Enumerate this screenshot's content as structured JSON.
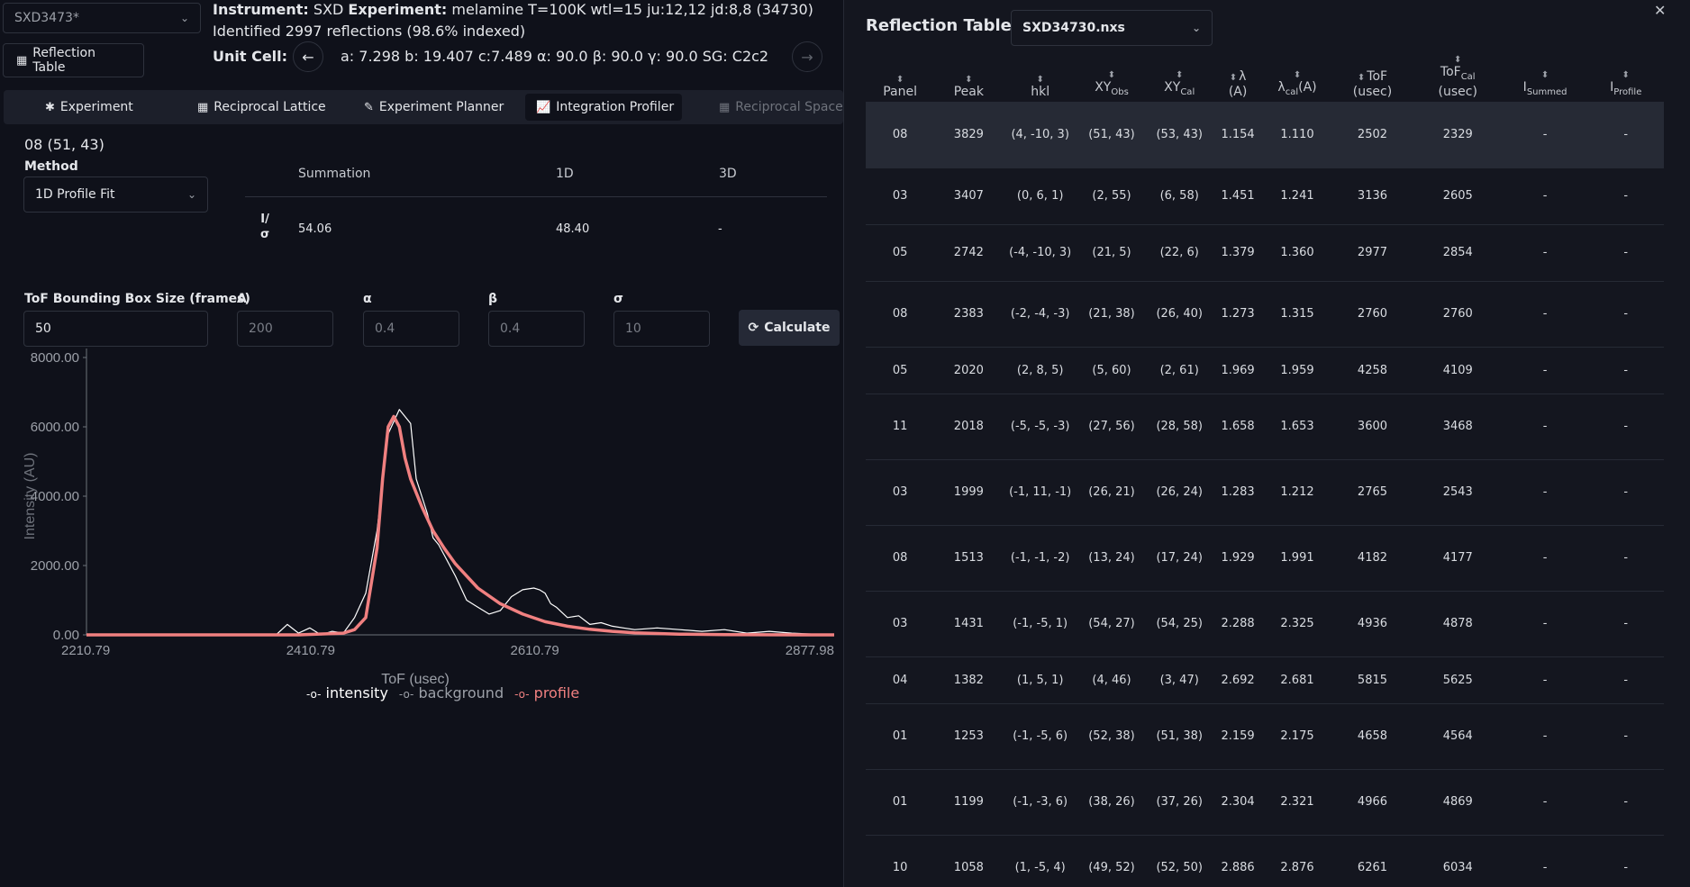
{
  "dataset_select": {
    "value": "SXD3473*"
  },
  "reflection_table_button": "Reflection Table",
  "info": {
    "instrument_label": "Instrument:",
    "instrument_value": "SXD",
    "experiment_label": "Experiment:",
    "experiment_value": "melamine T=100K wtl=15 ju:12,12 jd:8,8 (34730)",
    "identified": "Identified 2997 reflections (98.6% indexed)",
    "unit_cell_label": "Unit Cell:",
    "unit_cell_value": "a: 7.298 b: 19.407 c:7.489 α: 90.0 β: 90.0 γ: 90.0 SG: C2c2"
  },
  "tabs": [
    {
      "label": "Experiment",
      "icon": "asterisk-icon"
    },
    {
      "label": "Reciprocal Lattice",
      "icon": "grid-icon"
    },
    {
      "label": "Experiment Planner",
      "icon": "pencil-icon"
    },
    {
      "label": "Integration Profiler",
      "icon": "chart-icon",
      "active": true
    },
    {
      "label": "Reciprocal Space",
      "icon": "grid-icon",
      "disabled": true
    }
  ],
  "profiler": {
    "peak_title": "08 (51, 43)",
    "method_label": "Method",
    "method_value": "1D Profile Fit",
    "result_headers": [
      "Summation",
      "1D",
      "3D"
    ],
    "result_row_label_top": "I/",
    "result_row_label_bottom": "σ",
    "result_values": [
      "54.06",
      "48.40",
      "-"
    ],
    "tof_box_label": "ToF Bounding Box Size (frames)",
    "tof_box_value": "50",
    "param_labels": [
      "A",
      "α",
      "β",
      "σ"
    ],
    "param_placeholders": [
      "200",
      "0.4",
      "0.4",
      "10"
    ],
    "calculate_label": "Calculate"
  },
  "chart_data": {
    "type": "line",
    "xlabel": "ToF (usec)",
    "ylabel": "Intensity (AU)",
    "xlim": [
      2210.79,
      2877.98
    ],
    "ylim": [
      0,
      8000
    ],
    "x_ticks": [
      "2210.79",
      "2410.79",
      "2610.79",
      "2877.98"
    ],
    "y_ticks": [
      "0.00",
      "2000.00",
      "4000.00",
      "6000.00",
      "8000.00"
    ],
    "legend": [
      "intensity",
      "background",
      "profile"
    ],
    "legend_colors": {
      "intensity": "#ffffff",
      "background": "#9ca0a8",
      "profile": "#f08080"
    },
    "series": [
      {
        "name": "intensity",
        "color": "#ffffff",
        "x": [
          2210.79,
          2260,
          2300,
          2380,
          2390,
          2400,
          2410,
          2420,
          2430,
          2440,
          2450,
          2460,
          2470,
          2480,
          2490,
          2500,
          2505,
          2510,
          2515,
          2520,
          2525,
          2530,
          2540,
          2550,
          2560,
          2570,
          2580,
          2590,
          2600,
          2610,
          2615,
          2620,
          2625,
          2630,
          2640,
          2650,
          2660,
          2670,
          2680,
          2690,
          2700,
          2720,
          2740,
          2760,
          2780,
          2800,
          2820,
          2840,
          2860,
          2877.98
        ],
        "y": [
          0,
          0,
          0,
          0,
          300,
          50,
          200,
          0,
          100,
          50,
          500,
          1200,
          3000,
          5800,
          6500,
          6100,
          4500,
          4000,
          3500,
          2800,
          2600,
          2300,
          1700,
          1000,
          800,
          600,
          700,
          1100,
          1300,
          1350,
          1300,
          1200,
          900,
          800,
          500,
          550,
          300,
          350,
          250,
          200,
          150,
          200,
          150,
          100,
          150,
          50,
          100,
          50,
          20,
          0
        ]
      },
      {
        "name": "profile",
        "color": "#f08080",
        "x": [
          2210.79,
          2400,
          2440,
          2450,
          2460,
          2470,
          2475,
          2480,
          2485,
          2490,
          2495,
          2500,
          2510,
          2520,
          2530,
          2540,
          2560,
          2580,
          2600,
          2620,
          2640,
          2660,
          2680,
          2700,
          2740,
          2780,
          2877.98
        ],
        "y": [
          0,
          0,
          50,
          150,
          500,
          2500,
          4500,
          6000,
          6300,
          6000,
          5100,
          4500,
          3700,
          3000,
          2500,
          2050,
          1350,
          900,
          600,
          380,
          250,
          160,
          100,
          60,
          20,
          5,
          0
        ]
      }
    ]
  },
  "reflection_panel": {
    "title": "Reflection Table",
    "file_select": "SXD34730.nxs",
    "headers": [
      {
        "main": "Panel"
      },
      {
        "main": "Peak"
      },
      {
        "main": "hkl"
      },
      {
        "main": "XY",
        "sub": "Obs"
      },
      {
        "main": "XY",
        "sub": "Cal"
      },
      {
        "main": "λ",
        "line2": "(A)"
      },
      {
        "main": "λ",
        "sub": "cal",
        "after": "(A)"
      },
      {
        "main": "ToF",
        "line2": "(usec)"
      },
      {
        "main": "ToF",
        "sub": "Cal",
        "line2": "(usec)"
      },
      {
        "main": "I",
        "sub": "Summed"
      },
      {
        "main": "I",
        "sub": "Profile"
      }
    ],
    "rows": [
      [
        "08",
        "3829",
        "(4, -10, 3)",
        "(51, 43)",
        "(53, 43)",
        "1.154",
        "1.110",
        "2502",
        "2329",
        "-",
        "-"
      ],
      [
        "03",
        "3407",
        "(0, 6, 1)",
        "(2, 55)",
        "(6, 58)",
        "1.451",
        "1.241",
        "3136",
        "2605",
        "-",
        "-"
      ],
      [
        "05",
        "2742",
        "(-4, -10, 3)",
        "(21, 5)",
        "(22, 6)",
        "1.379",
        "1.360",
        "2977",
        "2854",
        "-",
        "-"
      ],
      [
        "08",
        "2383",
        "(-2, -4, -3)",
        "(21, 38)",
        "(26, 40)",
        "1.273",
        "1.315",
        "2760",
        "2760",
        "-",
        "-"
      ],
      [
        "05",
        "2020",
        "(2, 8, 5)",
        "(5, 60)",
        "(2, 61)",
        "1.969",
        "1.959",
        "4258",
        "4109",
        "-",
        "-"
      ],
      [
        "11",
        "2018",
        "(-5, -5, -3)",
        "(27, 56)",
        "(28, 58)",
        "1.658",
        "1.653",
        "3600",
        "3468",
        "-",
        "-"
      ],
      [
        "03",
        "1999",
        "(-1, 11, -1)",
        "(26, 21)",
        "(26, 24)",
        "1.283",
        "1.212",
        "2765",
        "2543",
        "-",
        "-"
      ],
      [
        "08",
        "1513",
        "(-1, -1, -2)",
        "(13, 24)",
        "(17, 24)",
        "1.929",
        "1.991",
        "4182",
        "4177",
        "-",
        "-"
      ],
      [
        "03",
        "1431",
        "(-1, -5, 1)",
        "(54, 27)",
        "(54, 25)",
        "2.288",
        "2.325",
        "4936",
        "4878",
        "-",
        "-"
      ],
      [
        "04",
        "1382",
        "(1, 5, 1)",
        "(4, 46)",
        "(3, 47)",
        "2.692",
        "2.681",
        "5815",
        "5625",
        "-",
        "-"
      ],
      [
        "01",
        "1253",
        "(-1, -5, 6)",
        "(52, 38)",
        "(51, 38)",
        "2.159",
        "2.175",
        "4658",
        "4564",
        "-",
        "-"
      ],
      [
        "01",
        "1199",
        "(-1, -3, 6)",
        "(38, 26)",
        "(37, 26)",
        "2.304",
        "2.321",
        "4966",
        "4869",
        "-",
        "-"
      ],
      [
        "10",
        "1058",
        "(1, -5, 4)",
        "(49, 52)",
        "(52, 50)",
        "2.886",
        "2.876",
        "6261",
        "6034",
        "-",
        "-"
      ]
    ],
    "row_heights": [
      73,
      63,
      63,
      73,
      52,
      73,
      73,
      73,
      73,
      52,
      73,
      73,
      73
    ],
    "selected_row": 0
  }
}
